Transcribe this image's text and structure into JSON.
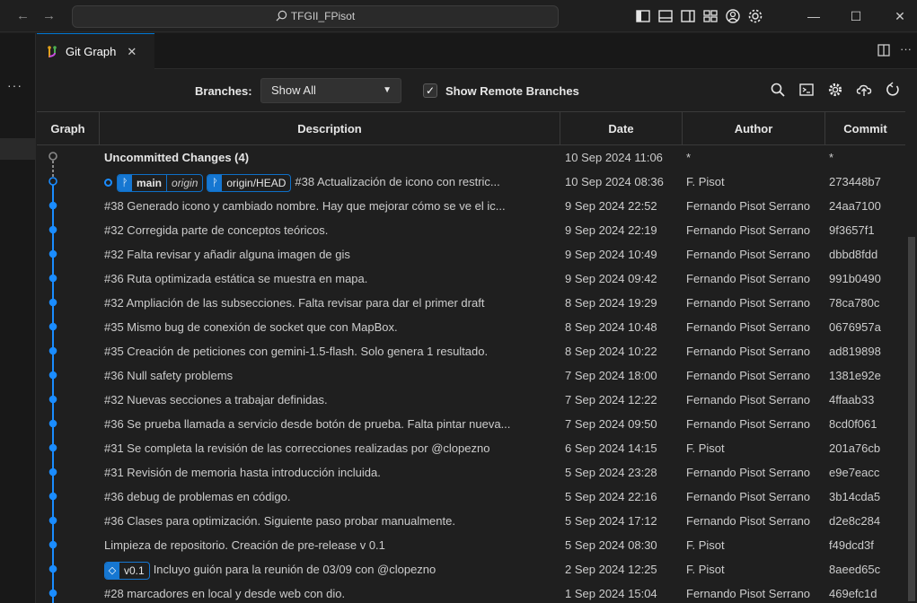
{
  "window": {
    "search_text": "TFGII_FPisot",
    "controls": {
      "minimize": "—",
      "maximize": "☐",
      "close": "✕"
    }
  },
  "tab": {
    "label": "Git Graph",
    "close": "✕"
  },
  "controls": {
    "branches_label": "Branches:",
    "branches_value": "Show All",
    "show_remote_checked": true,
    "show_remote_label": "Show Remote Branches"
  },
  "columns": {
    "graph": "Graph",
    "description": "Description",
    "date": "Date",
    "author": "Author",
    "commit": "Commit"
  },
  "rows": [
    {
      "desc": "Uncommitted Changes (4)",
      "date": "10 Sep 2024 11:06",
      "author": "*",
      "commit": "*"
    },
    {
      "desc": "#38 Actualización de icono con restric...",
      "date": "10 Sep 2024 08:36",
      "author": "F. Pisot",
      "commit": "273448b7"
    },
    {
      "desc": "#38 Generado icono y cambiado nombre. Hay que mejorar cómo se ve el ic...",
      "date": "9 Sep 2024 22:52",
      "author": "Fernando Pisot Serrano",
      "commit": "24aa7100"
    },
    {
      "desc": "#32 Corregida parte de conceptos teóricos.",
      "date": "9 Sep 2024 22:19",
      "author": "Fernando Pisot Serrano",
      "commit": "9f3657f1"
    },
    {
      "desc": "#32 Falta revisar y añadir alguna imagen de gis",
      "date": "9 Sep 2024 10:49",
      "author": "Fernando Pisot Serrano",
      "commit": "dbbd8fdd"
    },
    {
      "desc": "#36 Ruta optimizada estática se muestra en mapa.",
      "date": "9 Sep 2024 09:42",
      "author": "Fernando Pisot Serrano",
      "commit": "991b0490"
    },
    {
      "desc": "#32 Ampliación de las subsecciones. Falta revisar para dar el primer draft",
      "date": "8 Sep 2024 19:29",
      "author": "Fernando Pisot Serrano",
      "commit": "78ca780c"
    },
    {
      "desc": "#35 Mismo bug de conexión de socket que con MapBox.",
      "date": "8 Sep 2024 10:48",
      "author": "Fernando Pisot Serrano",
      "commit": "0676957a"
    },
    {
      "desc": "#35 Creación de peticiones con gemini-1.5-flash. Solo genera 1 resultado.",
      "date": "8 Sep 2024 10:22",
      "author": "Fernando Pisot Serrano",
      "commit": "ad819898"
    },
    {
      "desc": "#36 Null safety problems",
      "date": "7 Sep 2024 18:00",
      "author": "Fernando Pisot Serrano",
      "commit": "1381e92e"
    },
    {
      "desc": "#32 Nuevas secciones a trabajar definidas.",
      "date": "7 Sep 2024 12:22",
      "author": "Fernando Pisot Serrano",
      "commit": "4ffaab33"
    },
    {
      "desc": "#36 Se prueba llamada a servicio desde botón de prueba. Falta pintar nueva...",
      "date": "7 Sep 2024 09:50",
      "author": "Fernando Pisot Serrano",
      "commit": "8cd0f061"
    },
    {
      "desc": "#31 Se completa la revisión de las correcciones realizadas por @clopezno",
      "date": "6 Sep 2024 14:15",
      "author": "F. Pisot",
      "commit": "201a76cb"
    },
    {
      "desc": "#31 Revisión de memoria hasta introducción incluida.",
      "date": "5 Sep 2024 23:28",
      "author": "Fernando Pisot Serrano",
      "commit": "e9e7eacc"
    },
    {
      "desc": "#36 debug de problemas en código.",
      "date": "5 Sep 2024 22:16",
      "author": "Fernando Pisot Serrano",
      "commit": "3b14cda5"
    },
    {
      "desc": "#36 Clases para optimización. Siguiente paso probar manualmente.",
      "date": "5 Sep 2024 17:12",
      "author": "Fernando Pisot Serrano",
      "commit": "d2e8c284"
    },
    {
      "desc": "Limpieza de repositorio. Creación de pre-release v 0.1",
      "date": "5 Sep 2024 08:30",
      "author": "F. Pisot",
      "commit": "f49dcd3f"
    },
    {
      "desc": "Incluyo guión para la reunión de 03/09 con @clopezno",
      "date": "2 Sep 2024 12:25",
      "author": "F. Pisot",
      "commit": "8aeed65c"
    },
    {
      "desc": "#28 marcadores en local y desde web con dio.",
      "date": "1 Sep 2024 15:04",
      "author": "Fernando Pisot Serrano",
      "commit": "469efc1d"
    }
  ],
  "refs": {
    "main_branch": "main",
    "main_remote": "origin",
    "origin_head": "origin/HEAD",
    "tag": "v0.1"
  },
  "colors": {
    "accent": "#0078d4",
    "graph_line": "#1a8cff"
  }
}
